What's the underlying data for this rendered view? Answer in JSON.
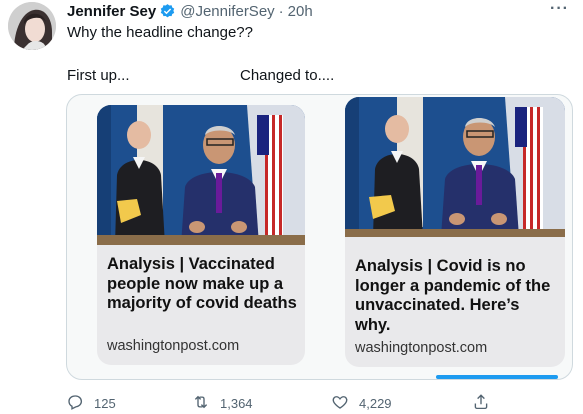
{
  "tweet": {
    "author_name": "Jennifer Sey",
    "handle": "@JenniferSey",
    "separator": "·",
    "time": "20h",
    "text": "Why the headline change??",
    "first_label": "First up...",
    "changed_label": "Changed to...."
  },
  "media": {
    "left": {
      "headline": "Analysis | Vaccinated people now make up a majority of covid deaths",
      "domain": "washingtonpost.com"
    },
    "right": {
      "headline": "Analysis | Covid is no longer a pandemic of the unvaccinated. Here’s why.",
      "domain": "washingtonpost.com"
    }
  },
  "actions": {
    "reply_count": "125",
    "retweet_count": "1,364",
    "like_count": "4,229"
  },
  "icons": {
    "verified": "verified-badge-icon",
    "more": "more-dots-icon",
    "reply": "reply-icon",
    "retweet": "retweet-icon",
    "like": "heart-icon",
    "share": "share-icon"
  },
  "colors": {
    "accent": "#1d9bf0",
    "text_primary": "#0f1419",
    "text_secondary": "#536471"
  }
}
